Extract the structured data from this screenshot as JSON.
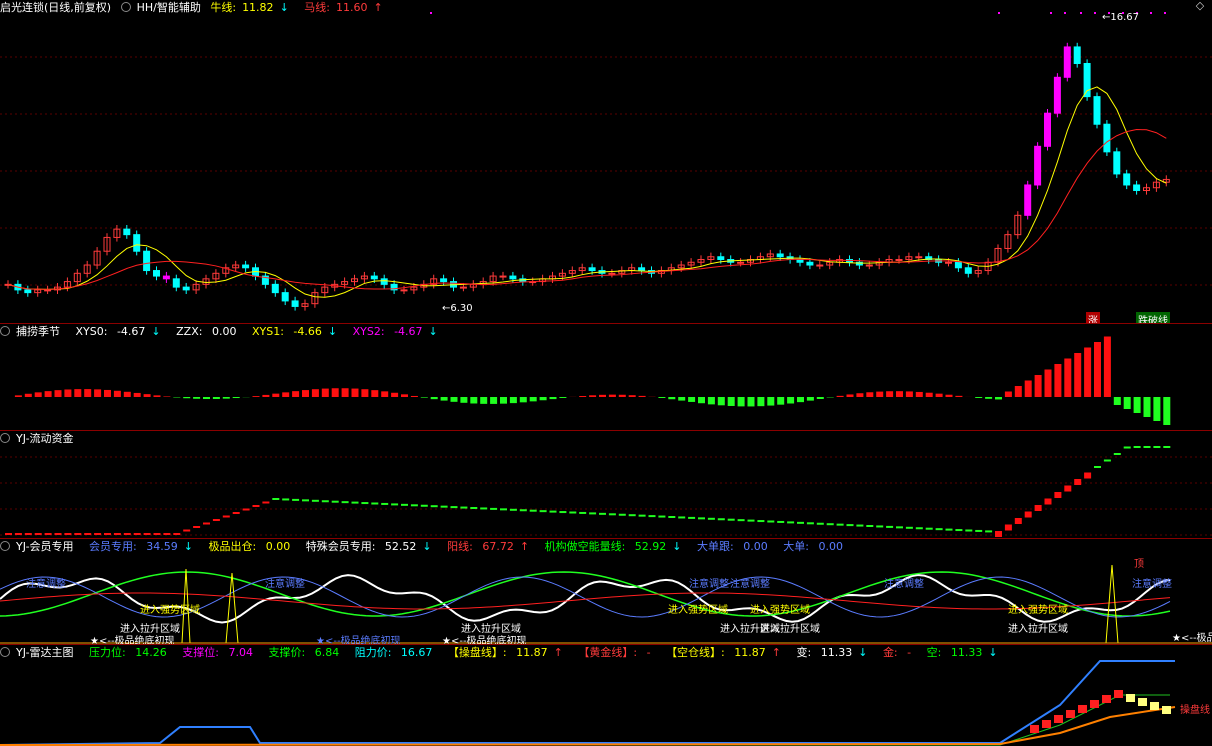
{
  "main": {
    "title": "启光连锁(日线,前复权)",
    "indicator": "HH/智能辅助",
    "bull_label": "牛线:",
    "bull_value": "11.82",
    "horse_label": "马线:",
    "horse_value": "11.60",
    "high_label": "16.67",
    "low_label": "6.30",
    "tag_rise": "涨",
    "tag_fall": "跌破线"
  },
  "pane2": {
    "title": "捕捞季节",
    "xys0_label": "XYS0:",
    "xys0": "-4.67",
    "zzx_label": "ZZX:",
    "zzx": "0.00",
    "xys1_label": "XYS1:",
    "xys1": "-4.66",
    "xys2_label": "XYS2:",
    "xys2": "-4.67"
  },
  "pane3": {
    "title": "YJ-流动资金"
  },
  "pane4": {
    "title": "YJ-会员专用",
    "member_label": "会员专用:",
    "member": "34.59",
    "extreme_label": "极品出仓:",
    "extreme": "0.00",
    "special_label": "特殊会员专用:",
    "special": "52.52",
    "resist_label": "阳线:",
    "resist": "67.72",
    "inst_label": "机构做空能量线:",
    "inst": "52.92",
    "big_label": "大单跟:",
    "big": "0.00",
    "big2_label": "大单:",
    "big2": "0.00",
    "ann_attention": "注意调整",
    "ann_strong": "进入强势区域",
    "ann_lift": "进入拉升区域",
    "ann_bottom": "★<--极品绝底初现",
    "ann_top": "顶",
    "ann_star_right": "★<--极品"
  },
  "pane5": {
    "title": "YJ-雷达主图",
    "press_label": "压力位:",
    "press": "14.26",
    "support_label": "支撑位:",
    "support": "7.04",
    "support_price_label": "支撑价:",
    "support_price": "6.84",
    "resist_price_label": "阻力价:",
    "resist_price": "16.67",
    "manip_label": "【操盘线】:",
    "manip": "11.87",
    "gold_label": "【黄金线】:",
    "gold": "-",
    "empty_label": "【空仓线】:",
    "empty": "11.87",
    "change_label": "变:",
    "change": "11.33",
    "jin_label": "金:",
    "jin": "-",
    "kong_label": "空:",
    "kong": "11.33",
    "right_tag": "操盘线"
  },
  "colors": {
    "up": "#ff3b3b",
    "down": "#00ffff",
    "magenta": "#ff00ff",
    "yellow": "#ffff00",
    "green": "#00ff00",
    "separator": "#8b0000",
    "grid": "#5a0000"
  }
}
